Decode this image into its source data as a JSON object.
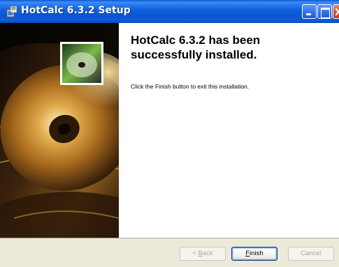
{
  "window": {
    "title": "HotCalc 6.3.2 Setup",
    "icon": "installer-icon",
    "controls": {
      "minimize": "minimize-icon",
      "maximize": "maximize-icon",
      "close": "close-icon"
    }
  },
  "content": {
    "heading": "HotCalc 6.3.2 has been successfully installed.",
    "message": "Click the Finish button to exit this installation."
  },
  "buttons": {
    "back": {
      "pre": "< ",
      "mnemonic": "B",
      "rest": "ack",
      "enabled": false
    },
    "finish": {
      "pre": "",
      "mnemonic": "F",
      "rest": "inish",
      "enabled": true,
      "default": true
    },
    "cancel": {
      "label": "Cancel",
      "enabled": false
    }
  },
  "colors": {
    "titlebar": "#0b56d2",
    "dialog_face": "#ece9d8",
    "close_button": "#d6502c"
  }
}
